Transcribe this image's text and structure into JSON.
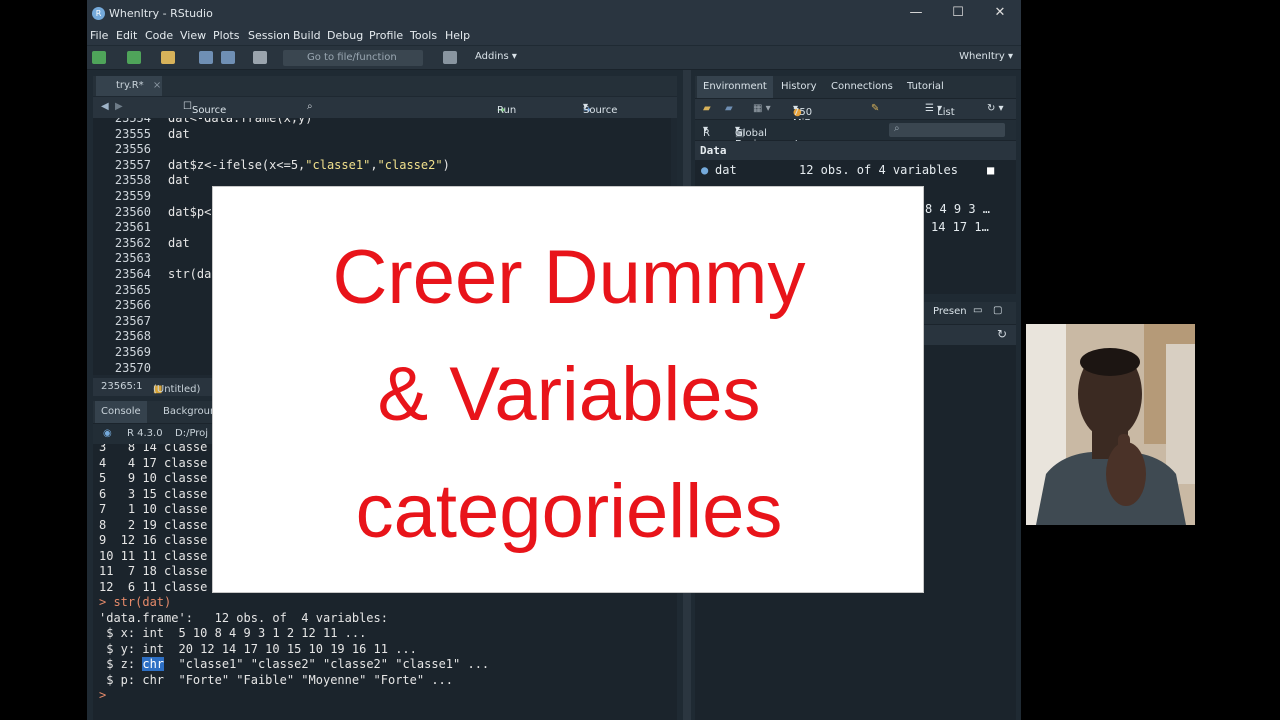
{
  "window": {
    "title": "WhenItry - RStudio",
    "controls": [
      "—",
      "☐",
      "✕"
    ]
  },
  "menu": [
    "File",
    "Edit",
    "Code",
    "View",
    "Plots",
    "Session",
    "Build",
    "Debug",
    "Profile",
    "Tools",
    "Help"
  ],
  "toolbar": {
    "goto_placeholder": "Go to file/function",
    "addins_label": "Addins",
    "project_label": "WhenItry"
  },
  "source": {
    "tab_label": "try.R*",
    "source_on_save_label": "Source on Save",
    "run_label": "Run",
    "source_label": "Source",
    "lines": [
      {
        "num": "23554",
        "text": "dat<-data.frame(x,y)"
      },
      {
        "num": "23555",
        "text": "dat"
      },
      {
        "num": "23556",
        "text": ""
      },
      {
        "num": "23557",
        "text": "dat$z<-ifelse(x<=5,\"classe1\",\"classe2\")"
      },
      {
        "num": "23558",
        "text": "dat"
      },
      {
        "num": "23559",
        "text": ""
      },
      {
        "num": "23560",
        "text": "dat$p<"
      },
      {
        "num": "23561",
        "text": ""
      },
      {
        "num": "23562",
        "text": "dat"
      },
      {
        "num": "23563",
        "text": ""
      },
      {
        "num": "23564",
        "text": "str(da"
      },
      {
        "num": "23565",
        "text": ""
      },
      {
        "num": "23566",
        "text": ""
      },
      {
        "num": "23567",
        "text": ""
      },
      {
        "num": "23568",
        "text": ""
      },
      {
        "num": "23569",
        "text": ""
      },
      {
        "num": "23570",
        "text": ""
      }
    ],
    "status_position": "23565:1",
    "status_scope": "(Untitled)"
  },
  "console": {
    "tabs": [
      "Console",
      "Background"
    ],
    "r_version": "R 4.3.0",
    "path": "D:/Proj",
    "lines": [
      {
        "text": "3   8 14 classe",
        "kind": "out"
      },
      {
        "text": "4   4 17 classe",
        "kind": "out"
      },
      {
        "text": "5   9 10 classe",
        "kind": "out"
      },
      {
        "text": "6   3 15 classe",
        "kind": "out"
      },
      {
        "text": "7   1 10 classe",
        "kind": "out"
      },
      {
        "text": "8   2 19 classe",
        "kind": "out"
      },
      {
        "text": "9  12 16 classe",
        "kind": "out"
      },
      {
        "text": "10 11 11 classe",
        "kind": "out"
      },
      {
        "text": "11  7 18 classe",
        "kind": "out"
      },
      {
        "text": "12  6 11 classe",
        "kind": "out"
      },
      {
        "text": "> str(dat)",
        "kind": "cmd"
      },
      {
        "text": "'data.frame':\t12 obs. of  4 variables:",
        "kind": "out"
      },
      {
        "text": " $ x: int  5 10 8 4 9 3 1 2 12 11 ...",
        "kind": "out"
      },
      {
        "text": " $ y: int  20 12 14 17 10 15 10 19 16 11 ...",
        "kind": "out"
      },
      {
        "text": " $ p: chr  \"Forte\" \"Faible\" \"Moyenne\" \"Forte\" ...",
        "kind": "out"
      }
    ],
    "z_line": {
      "prefix": " $ z: ",
      "type": "chr",
      "rest": "  \"classe1\" \"classe2\" \"classe2\" \"classe1\" ..."
    },
    "prompt": ">"
  },
  "environment": {
    "tabs": [
      "Environment",
      "History",
      "Connections",
      "Tutorial"
    ],
    "memory": "750 MiB",
    "view_mode": "List",
    "lang": "R",
    "scope": "Global Environment",
    "section": "Data",
    "object_name": "dat",
    "object_desc": "12 obs. of 4 variables",
    "peek_x": "8 4 9 3 …",
    "peek_y": "14 17 1…"
  },
  "files": {
    "tab_label": "Presen"
  },
  "overlay": {
    "line1": "Creer Dummy",
    "line2": "& Variables",
    "line3": "categorielles",
    "color": "#e8141a"
  }
}
